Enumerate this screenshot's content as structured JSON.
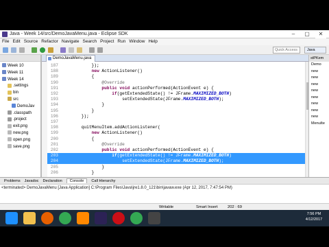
{
  "window_title": "Java - Week 14/src/DemoJavaMenu.java - Eclipse SDK",
  "window_controls": {
    "minimize": "–",
    "maximize": "▢",
    "close": "✕"
  },
  "menu": [
    "File",
    "Edit",
    "Source",
    "Refactor",
    "Navigate",
    "Search",
    "Project",
    "Run",
    "Window",
    "Help"
  ],
  "quick_access": "Quick Access",
  "perspective": "Java",
  "package_tree": [
    {
      "label": "Week 10",
      "icon": "project-folder-icon"
    },
    {
      "label": "Week 11",
      "icon": "project-folder-icon"
    },
    {
      "label": "Week 14",
      "icon": "project-folder-icon"
    },
    {
      "label": ".settings",
      "icon": "folder-icon"
    },
    {
      "label": "bin",
      "icon": "folder-icon"
    },
    {
      "label": "src",
      "icon": "source-folder-icon"
    },
    {
      "label": "DemoJav",
      "icon": "java-file-icon"
    },
    {
      "label": ".classpath",
      "icon": "file-icon"
    },
    {
      "label": ".project",
      "icon": "file-icon"
    },
    {
      "label": "exit.png",
      "icon": "image-file-icon"
    },
    {
      "label": "new.png",
      "icon": "image-file-icon"
    },
    {
      "label": "open.png",
      "icon": "image-file-icon"
    },
    {
      "label": "save.png",
      "icon": "image-file-icon"
    }
  ],
  "editor_tab": "DemoJavaMenu.java",
  "code_lines": [
    {
      "n": "187",
      "t": "            });",
      "hl": false
    },
    {
      "n": "188",
      "t": "            new ActionListener()",
      "hl": false
    },
    {
      "n": "189",
      "t": "            {",
      "hl": false
    },
    {
      "n": "190",
      "t": "                @Override",
      "hl": false
    },
    {
      "n": "191",
      "t": "                public void actionPerformed(ActionEvent e) {",
      "hl": false
    },
    {
      "n": "192",
      "t": "                    if(getExtendedState() != JFrame.MAXIMIZED_BOTH)",
      "hl": false
    },
    {
      "n": "193",
      "t": "                        setExtendedState(JFrame.MAXIMIZED_BOTH);",
      "hl": false
    },
    {
      "n": "194",
      "t": "                }",
      "hl": false
    },
    {
      "n": "195",
      "t": "            }",
      "hl": false
    },
    {
      "n": "196",
      "t": "        });",
      "hl": false
    },
    {
      "n": "197",
      "t": "",
      "hl": false
    },
    {
      "n": "198",
      "t": "        quitMenuItem.addActionListener(",
      "hl": false
    },
    {
      "n": "199",
      "t": "            new ActionListener()",
      "hl": false
    },
    {
      "n": "200",
      "t": "            {",
      "hl": false
    },
    {
      "n": "201",
      "t": "                @Override",
      "hl": false
    },
    {
      "n": "202",
      "t": "                public void actionPerformed(ActionEvent e) {",
      "hl": false
    },
    {
      "n": "203",
      "t": "                    if(getExtendedState() != JFrame.MAXIMIZED_BOTH)",
      "hl": true
    },
    {
      "n": "204",
      "t": "                        setExtendedState(JFrame.MAXIMIZED_BOTH);",
      "hl": true
    },
    {
      "n": "205",
      "t": "                }",
      "hl": false
    },
    {
      "n": "206",
      "t": "            }",
      "hl": false
    }
  ],
  "outline_items": [
    "Demo",
    "new",
    "new",
    "new",
    "new",
    "new",
    "new",
    "new",
    "new",
    "MenuIte"
  ],
  "outline_tab": "stPKem",
  "console_tabs": [
    "Problems",
    "Javadoc",
    "Declaration",
    "Console",
    "Call Hierarchy"
  ],
  "console_text": "<terminated> DemoJavaMenu [Java Application] C:\\Program Files\\Java\\jre1.8.0_121\\bin\\javaw.exe (Apr 12, 2017, 7:47:54 PM)",
  "status": {
    "writable": "Writable",
    "insert": "Smart Insert",
    "position": "202 : 69"
  },
  "clock": {
    "time": "7:56 PM",
    "date": "4/12/2017"
  },
  "taskbar_icons": [
    "windows-start-icon",
    "file-explorer-icon",
    "firefox-icon",
    "chrome-icon",
    "vlc-icon",
    "eclipse-icon",
    "opera-icon",
    "chrome-icon",
    "app-icon"
  ]
}
